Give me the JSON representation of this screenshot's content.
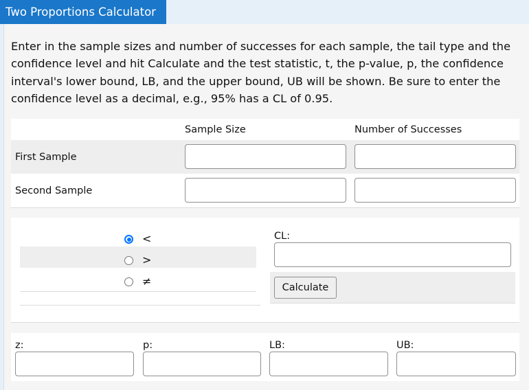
{
  "title": "Two Proportions Calculator",
  "intro": "Enter in the sample sizes and number of successes for each sample, the tail type and the confidence level and hit Calculate and the test statistic, t, the p-value, p, the confidence interval's lower bound, LB, and the upper bound, UB will be shown.  Be sure to enter the confidence level as a decimal, e.g., 95% has a CL of 0.95.",
  "samples": {
    "headers": {
      "size": "Sample Size",
      "successes": "Number of Successes"
    },
    "rows": [
      {
        "label": "First Sample",
        "size": "",
        "successes": ""
      },
      {
        "label": "Second Sample",
        "size": "",
        "successes": ""
      }
    ]
  },
  "tail": {
    "options": [
      {
        "symbol": "<",
        "checked": true
      },
      {
        "symbol": ">",
        "checked": false
      },
      {
        "symbol": "≠",
        "checked": false
      }
    ]
  },
  "cl": {
    "label": "CL:",
    "value": ""
  },
  "calculate_label": "Calculate",
  "results": {
    "z": {
      "label": "z:",
      "value": ""
    },
    "p": {
      "label": "p:",
      "value": ""
    },
    "lb": {
      "label": "LB:",
      "value": ""
    },
    "ub": {
      "label": "UB:",
      "value": ""
    }
  },
  "colors": {
    "title_bg": "#1a77c9",
    "radio_accent": "#0075ff"
  }
}
